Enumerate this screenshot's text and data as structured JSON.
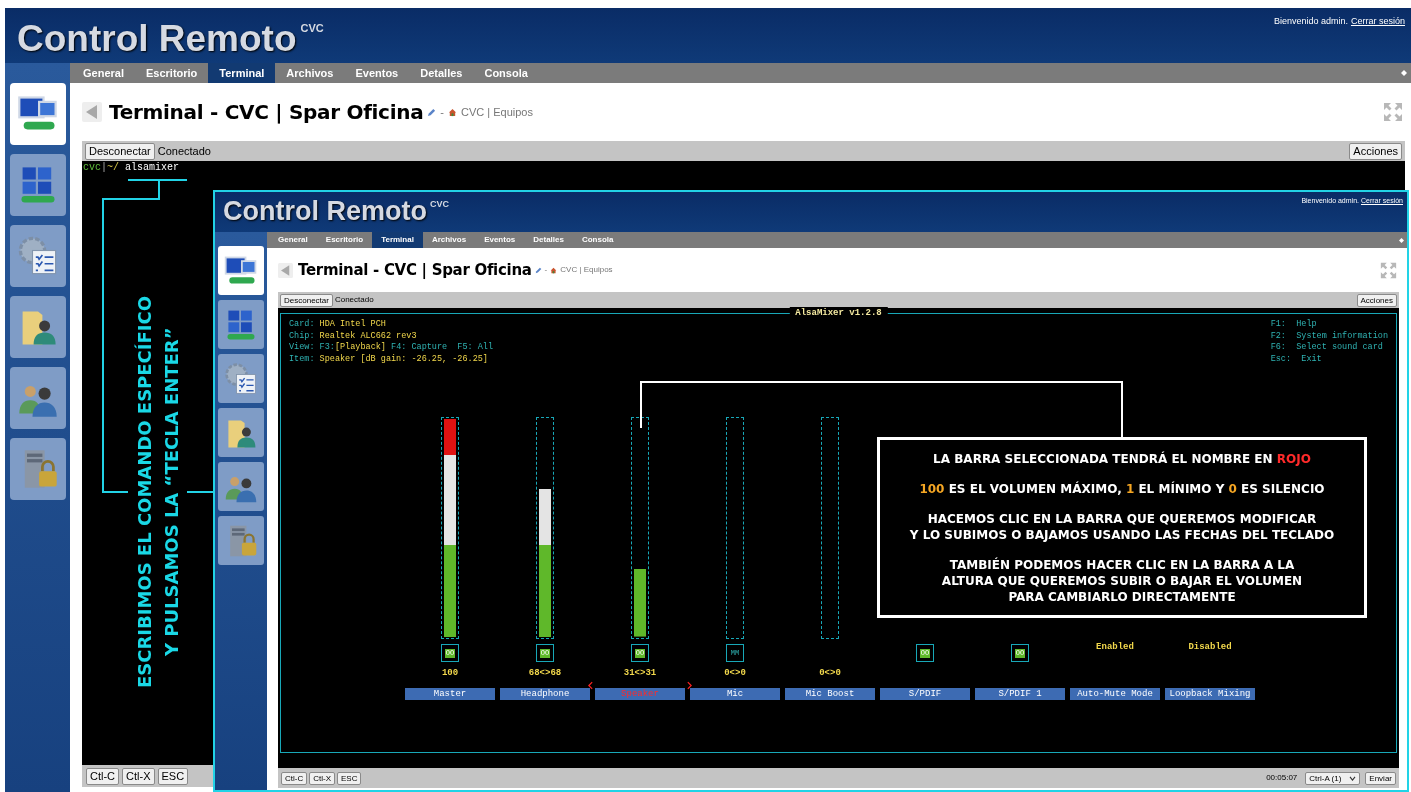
{
  "outer": {
    "header": {
      "title": "Control Remoto",
      "subtitle": "CVC",
      "welcome": "Bienvenido admin.",
      "logout": "Cerrar sesión"
    },
    "sidebar": {
      "items": [
        {
          "selected": true
        },
        {
          "selected": false
        },
        {
          "selected": false
        },
        {
          "selected": false
        },
        {
          "selected": false
        },
        {
          "selected": false
        }
      ]
    },
    "tabs": [
      {
        "label": "General",
        "selected": false
      },
      {
        "label": "Escritorio",
        "selected": false
      },
      {
        "label": "Terminal",
        "selected": true
      },
      {
        "label": "Archivos",
        "selected": false
      },
      {
        "label": "Eventos",
        "selected": false
      },
      {
        "label": "Detalles",
        "selected": false
      },
      {
        "label": "Consola",
        "selected": false
      }
    ],
    "page_title": "Terminal - CVC | Spar Oficina",
    "breadcrumb_separator": "-",
    "breadcrumb": "CVC | Equipos",
    "toolbar": {
      "disconnect": "Desconectar",
      "status": "Conectado",
      "actions": "Acciones"
    },
    "terminal": {
      "prompt_user": "cvc",
      "prompt_sep": "|",
      "prompt_path": "~/",
      "command": "alsamixer"
    },
    "footer": {
      "buttons": [
        "Ctl-C",
        "Ctl-X",
        "ESC"
      ]
    }
  },
  "inner": {
    "header": {
      "title": "Control Remoto",
      "subtitle": "CVC",
      "welcome": "Bienvenido admin.",
      "logout": "Cerrar sesión"
    },
    "sidebar": {
      "items": [
        {
          "selected": true
        },
        {
          "selected": false
        },
        {
          "selected": false
        },
        {
          "selected": false
        },
        {
          "selected": false
        },
        {
          "selected": false
        }
      ]
    },
    "tabs": [
      {
        "label": "General",
        "selected": false
      },
      {
        "label": "Escritorio",
        "selected": false
      },
      {
        "label": "Terminal",
        "selected": true
      },
      {
        "label": "Archivos",
        "selected": false
      },
      {
        "label": "Eventos",
        "selected": false
      },
      {
        "label": "Detalles",
        "selected": false
      },
      {
        "label": "Consola",
        "selected": false
      }
    ],
    "page_title": "Terminal - CVC | Spar Oficina",
    "breadcrumb_separator": "-",
    "breadcrumb": "CVC | Equipos",
    "toolbar": {
      "disconnect": "Desconectar",
      "status": "Conectado",
      "actions": "Acciones"
    },
    "mixer": {
      "title": "AlsaMixer v1.2.8",
      "info": [
        [
          {
            "text": "Card: ",
            "kind": "label"
          },
          {
            "text": "HDA Intel PCH",
            "kind": "value"
          }
        ],
        [
          {
            "text": "Chip: ",
            "kind": "label"
          },
          {
            "text": "Realtek ALC662 rev3",
            "kind": "value"
          }
        ],
        [
          {
            "text": "View: F3:",
            "kind": "label"
          },
          {
            "text": "[Playback]",
            "kind": "value"
          },
          {
            "text": " F4: Capture  F5: All",
            "kind": "label"
          }
        ],
        [
          {
            "text": "Item: ",
            "kind": "label"
          },
          {
            "text": "Speaker [dB gain: -26.25, -26.25]",
            "kind": "value"
          }
        ]
      ],
      "keys": [
        {
          "key": "F1:",
          "text": "Help"
        },
        {
          "key": "F2:",
          "text": "System information"
        },
        {
          "key": "F6:",
          "text": "Select sound card"
        },
        {
          "key": "Esc:",
          "text": "Exit"
        }
      ],
      "controls": [
        {
          "name": "Master",
          "kind": "slider",
          "level": 1,
          "mute": "OO",
          "muted": false,
          "value": "100",
          "selected": false
        },
        {
          "name": "Headphone",
          "kind": "slider",
          "level": 0.68,
          "mute": "OO",
          "muted": false,
          "value": "68<>68",
          "selected": false
        },
        {
          "name": "Speaker",
          "kind": "slider",
          "level": 0.31,
          "mute": "OO",
          "muted": false,
          "value": "31<>31",
          "selected": true
        },
        {
          "name": "Mic",
          "kind": "slider",
          "level": 0,
          "mute": "MM",
          "muted": true,
          "value": "0<>0",
          "selected": false
        },
        {
          "name": "Mic Boost",
          "kind": "slider",
          "level": 0,
          "value": "0<>0",
          "selected": false
        },
        {
          "name": "S/PDIF",
          "kind": "switch",
          "mute": "OO",
          "muted": false,
          "selected": false
        },
        {
          "name": "S/PDIF 1",
          "kind": "switch",
          "mute": "OO",
          "muted": false,
          "selected": false
        },
        {
          "name": "Auto-Mute Mode",
          "kind": "enum",
          "value": "Enabled",
          "selected": false
        },
        {
          "name": "Loopback Mixing",
          "kind": "enum",
          "value": "Disabled",
          "selected": false
        }
      ]
    },
    "footer": {
      "buttons": [
        "Ctl-C",
        "Ctl-X",
        "ESC"
      ],
      "time": "00:05:07",
      "select": "Ctrl-A (1)",
      "send": "Enviar"
    }
  },
  "annotation": {
    "lines": [
      "ESCRIBIMOS EL COMANDO ESPECÍFICO",
      "Y PULSAMOS LA “TECLA ENTER”"
    ]
  },
  "note": {
    "paragraphs": [
      {
        "lines": [
          [
            {
              "text": "LA BARRA SELECCIONADA TENDRÁ EL NOMBRE EN ",
              "kind": "plain"
            },
            {
              "text": "ROJO",
              "kind": "red"
            }
          ]
        ]
      },
      {
        "lines": [
          [
            {
              "text": "100",
              "kind": "orange"
            },
            {
              "text": " ES EL VOLUMEN MÁXIMO, ",
              "kind": "plain"
            },
            {
              "text": "1",
              "kind": "orange"
            },
            {
              "text": " EL MÍNIMO Y ",
              "kind": "plain"
            },
            {
              "text": "0",
              "kind": "orange"
            },
            {
              "text": " ES SILENCIO",
              "kind": "plain"
            }
          ]
        ]
      },
      {
        "lines": [
          [
            {
              "text": "HACEMOS CLIC EN LA BARRA QUE QUEREMOS MODIFICAR",
              "kind": "plain"
            }
          ],
          [
            {
              "text": "Y LO SUBIMOS O BAJAMOS USANDO LAS FECHAS DEL TECLADO",
              "kind": "plain"
            }
          ]
        ]
      },
      {
        "lines": [
          [
            {
              "text": "TAMBIÉN PODEMOS HACER CLIC EN LA BARRA A LA",
              "kind": "plain"
            }
          ],
          [
            {
              "text": "ALTURA QUE QUEREMOS SUBIR O BAJAR EL VOLUMEN",
              "kind": "plain"
            }
          ],
          [
            {
              "text": "PARA CAMBIARLO DIRECTAMENTE",
              "kind": "plain"
            }
          ]
        ]
      }
    ]
  }
}
